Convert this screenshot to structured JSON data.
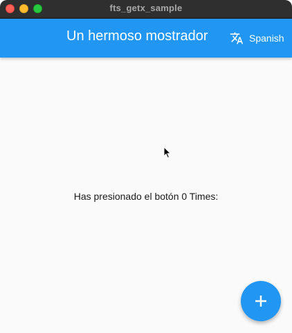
{
  "window": {
    "title": "fts_getx_sample"
  },
  "appbar": {
    "title": "Un hermoso mostrador",
    "language_button_label": "Spanish",
    "language_icon": "translate-icon",
    "color": "#2196f3"
  },
  "content": {
    "counter_text": "Has presionado el botón 0 Times:"
  },
  "fab": {
    "icon": "add-icon",
    "color": "#2196f3"
  },
  "colors": {
    "titlebar": "#2f2f2f",
    "background": "#fafafa",
    "close": "#ff5f57",
    "minimize": "#febc2e",
    "maximize": "#28c840"
  }
}
